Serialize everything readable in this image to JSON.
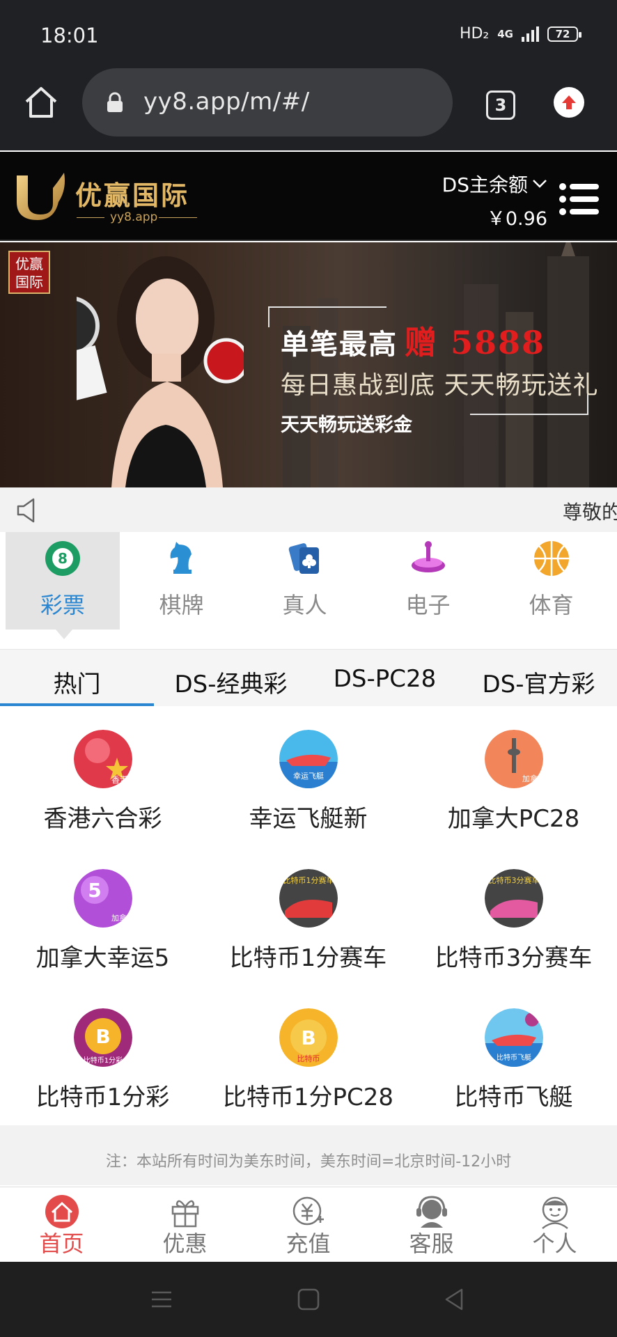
{
  "status_bar": {
    "time": "18:01",
    "network": "HD₂",
    "signal": "4G",
    "battery": "72"
  },
  "browser": {
    "url": "yy8.app/m/#/",
    "tab_count": "3"
  },
  "header": {
    "logo_name": "优赢国际",
    "logo_domain": "yy8.app",
    "balance_label": "DS主余额",
    "balance_amount": "￥0.96"
  },
  "banner": {
    "badge_text": "优赢国际",
    "headline_prefix": "单笔最高",
    "headline_highlight": "赠 5888",
    "line2": "每日惠战到底 天天畅玩送礼",
    "line3": "天天畅玩送彩金"
  },
  "marquee": {
    "text": "尊敬的会"
  },
  "categories": [
    {
      "label": "彩票",
      "icon": "lottery-ball-icon",
      "active": true
    },
    {
      "label": "棋牌",
      "icon": "chess-knight-icon",
      "active": false
    },
    {
      "label": "真人",
      "icon": "cards-icon",
      "active": false
    },
    {
      "label": "电子",
      "icon": "slot-machine-icon",
      "active": false
    },
    {
      "label": "体育",
      "icon": "basketball-icon",
      "active": false
    }
  ],
  "subtabs": [
    {
      "label": "热门",
      "active": true
    },
    {
      "label": "DS-经典彩",
      "active": false
    },
    {
      "label": "DS-PC28",
      "active": false
    },
    {
      "label": "DS-官方彩",
      "active": false
    }
  ],
  "games": [
    {
      "name": "香港六合彩",
      "icon_caption": "香港"
    },
    {
      "name": "幸运飞艇新",
      "icon_caption": "幸运飞艇"
    },
    {
      "name": "加拿大PC28",
      "icon_caption": "加拿大"
    },
    {
      "name": "加拿大幸运5",
      "icon_caption": "加拿大"
    },
    {
      "name": "比特币1分赛车",
      "icon_caption": "比特币1分赛车"
    },
    {
      "name": "比特币3分赛车",
      "icon_caption": "比特币3分赛车"
    },
    {
      "name": "比特币1分彩",
      "icon_caption": "比特币1分彩"
    },
    {
      "name": "比特币1分PC28",
      "icon_caption": "比特币"
    },
    {
      "name": "比特币飞艇",
      "icon_caption": "比特币飞艇"
    }
  ],
  "note": "注：本站所有时间为美东时间，美东时间=北京时间-12小时",
  "bottom_nav": [
    {
      "label": "首页",
      "icon": "home-icon",
      "active": true
    },
    {
      "label": "优惠",
      "icon": "gift-icon",
      "active": false
    },
    {
      "label": "充值",
      "icon": "recharge-icon",
      "active": false
    },
    {
      "label": "客服",
      "icon": "customer-service-icon",
      "active": false
    },
    {
      "label": "个人",
      "icon": "user-icon",
      "active": false
    }
  ],
  "colors": {
    "accent_blue": "#2a86d0",
    "accent_red": "#e34a4a",
    "header_bg": "#070707",
    "gold": "#e2b866"
  }
}
